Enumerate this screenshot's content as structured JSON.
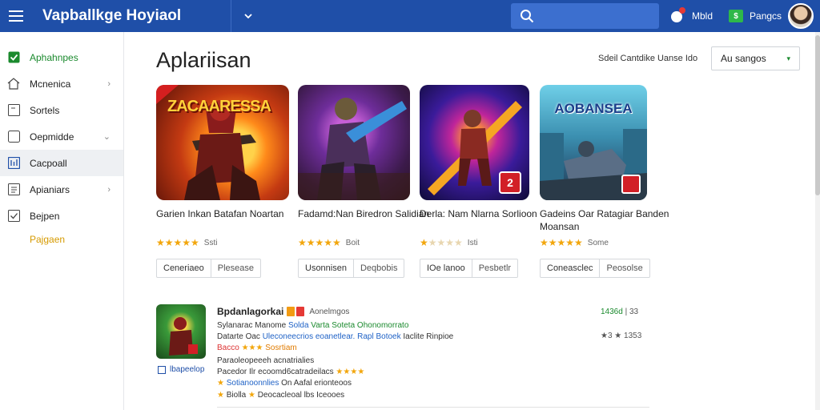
{
  "header": {
    "title": "Vapballkge Hoyiaol",
    "search_placeholder": "",
    "notifications_label": "Mbld",
    "store_label": "Pangcs",
    "store_icon_text": "$"
  },
  "sidebar": {
    "items": [
      {
        "label": "Aphahnpes",
        "icon": "check-square-icon"
      },
      {
        "label": "Mcnenica",
        "icon": "home-icon",
        "chevron": "›"
      },
      {
        "label": "Sortels",
        "icon": "edit-icon"
      },
      {
        "label": "Oepmidde",
        "icon": "chat-icon",
        "chevron": "⌄"
      },
      {
        "label": "Cacpoall",
        "icon": "grid-icon"
      },
      {
        "label": "Apianiars",
        "icon": "list-icon",
        "chevron": "›"
      },
      {
        "label": "Bejpen",
        "icon": "checkbox-icon"
      }
    ],
    "sub_item": "Pajgaen"
  },
  "main": {
    "title": "Aplariisan",
    "sort_label": "Sdeil Cantdike Uanse  Ido",
    "sort_value": "Au sangos",
    "sort_caret": "▾"
  },
  "cards": [
    {
      "title": "Garien Inkan Batafan Noartan",
      "rating": 5,
      "count": "Ssti",
      "action1": "Ceneriaeo",
      "action2": "Plesease",
      "art_label": "ZACAARESSA"
    },
    {
      "title": "Fadamd:Nan Biredron Salidian",
      "rating": 5,
      "count": "Boit",
      "action1": "Usonnisen",
      "action2": "Deqbobis",
      "art_label": ""
    },
    {
      "title": "Derla: Nam Nlarna Sorlioon",
      "rating": 1,
      "count": "Isti",
      "action1": "IOe lanoo",
      "action2": "Pesbetlr",
      "art_label": "",
      "badge": "2"
    },
    {
      "title": "Gadeins Oar Ratagiar Banden Moansan",
      "rating": 5,
      "count": "Some",
      "action1": "Coneasclec",
      "action2": "Peosolse",
      "art_label": "AOBANSEA"
    }
  ],
  "list_item": {
    "title": "Bpdanlagorkai",
    "developer": "Aonelmgos",
    "under_label": "lbapeelop",
    "line1_a": "Sylanarac Manome",
    "line1_b": "Solda",
    "line1_c": "Varta Soteta Ohonomorrato",
    "line2_a": "Datarte Oac",
    "line2_b": "Uleconeecrios eoanetlear.",
    "line2_c": "Rapl Botoek",
    "line2_d": "Iaclite Rinpioe",
    "line3_a": "Bacco",
    "line3_stars": "★★★",
    "line3_b": "Sosrtiam",
    "line4": "Paraoleopeeeh acnatrialies",
    "line5_a": "Pacedor Ilr ecoomd6catradeilacs",
    "line5_stars": "★★★★",
    "line6_a": "Sotianoonnlies",
    "line6_b": "On Aafal erionteoos",
    "line7_a": "Biolla",
    "line7_b": "Deocacleoal lbs Iceooes",
    "right1": "1436d",
    "right1_b": "| 33",
    "right2": "★3 ★ 1353"
  },
  "colors": {
    "header_bg": "#1f4fa8",
    "accent_green": "#1b8a2e",
    "star": "#f2a60c"
  }
}
